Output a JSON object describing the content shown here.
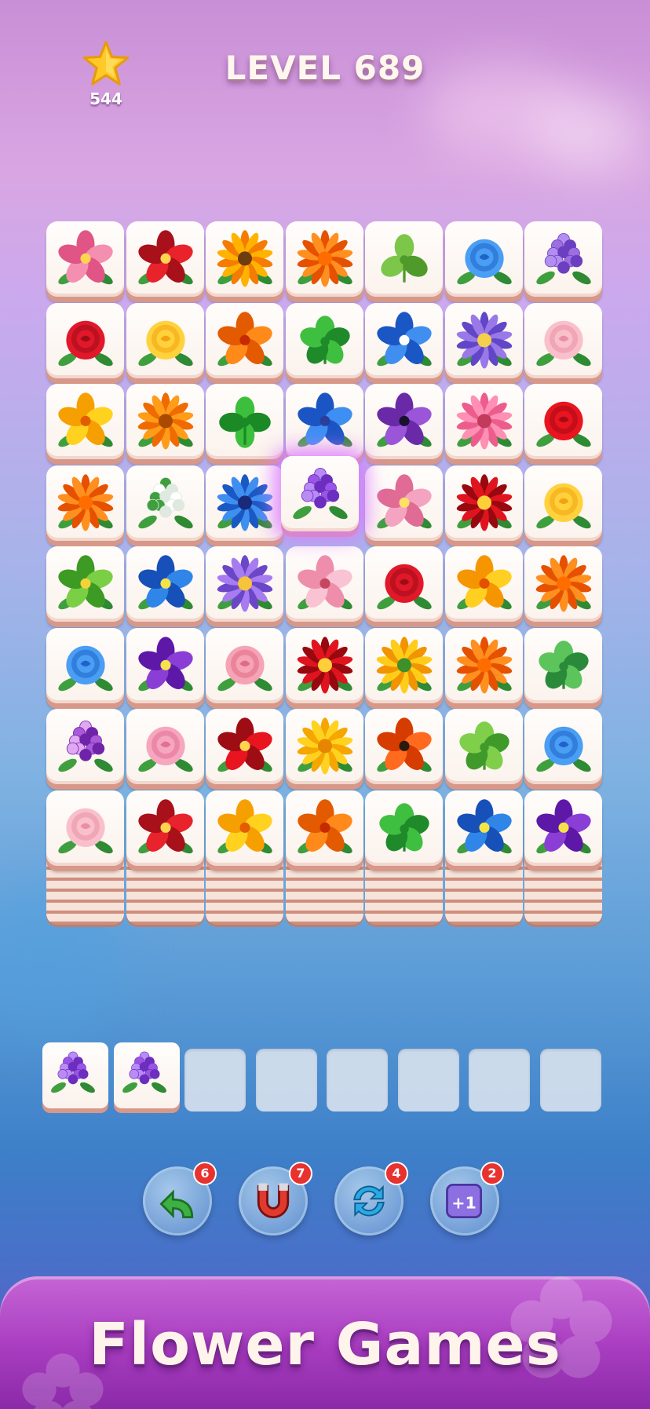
{
  "header": {
    "coins": "544",
    "level_title": "LEVEL 689"
  },
  "board": {
    "rows": 8,
    "cols": 7,
    "selected": {
      "row": 3,
      "col": 3
    },
    "tiles": [
      [
        "hibiscus-pink",
        "hibiscus-red",
        "sunflower",
        "marigold-orange",
        "ginkgo-leaf",
        "rose-blue",
        "hyacinth-purple"
      ],
      [
        "rose-red",
        "rose-yellow",
        "nasturtium-orange",
        "clover-green",
        "morning-glory-blue",
        "dahlia-purple",
        "camellia-pink"
      ],
      [
        "lily-yellow",
        "gerbera-orange",
        "four-leaf-clover",
        "cornflower-blue",
        "anemone-purple",
        "gerbera-pink",
        "ranunculus-red"
      ],
      [
        "marigold-orange",
        "lily-of-the-valley",
        "daisy-blue",
        "lilac-purple",
        "orchid-pink",
        "dahlia-red",
        "rose-yellow"
      ],
      [
        "pansy-green",
        "orchid-blue",
        "aster-purple",
        "cherry-blossom-pink",
        "rose-red",
        "hibiscus-yellow",
        "marigold-orange"
      ],
      [
        "rose-blue",
        "violet-purple",
        "rose-bouquet-pink",
        "dahlia-red",
        "chrysanthemum-yellow",
        "marigold-orange",
        "succulent-green"
      ],
      [
        "hydrangea-purple",
        "peony-pink",
        "anthurium-red",
        "gerbera-yellow",
        "poppy-orange",
        "lettuce-green",
        "rose-blue"
      ],
      [
        "camellia-pink",
        "hibiscus-red",
        "lily-yellow",
        "nasturtium-orange",
        "clover-green",
        "orchid-blue",
        "violet-purple"
      ]
    ]
  },
  "tray": {
    "slots": 8,
    "items": [
      "lilac-purple",
      "lilac-purple"
    ]
  },
  "tools": [
    {
      "name": "undo-icon",
      "count": "6",
      "color": "#3cb043"
    },
    {
      "name": "magnet-icon",
      "count": "7",
      "color": "#e03a2f"
    },
    {
      "name": "shuffle-icon",
      "count": "4",
      "color": "#29a9e8"
    },
    {
      "name": "plus-one-icon",
      "count": "2",
      "color": "#8c6fe0",
      "label": "+1"
    }
  ],
  "footer": {
    "title": "Flower Games"
  }
}
